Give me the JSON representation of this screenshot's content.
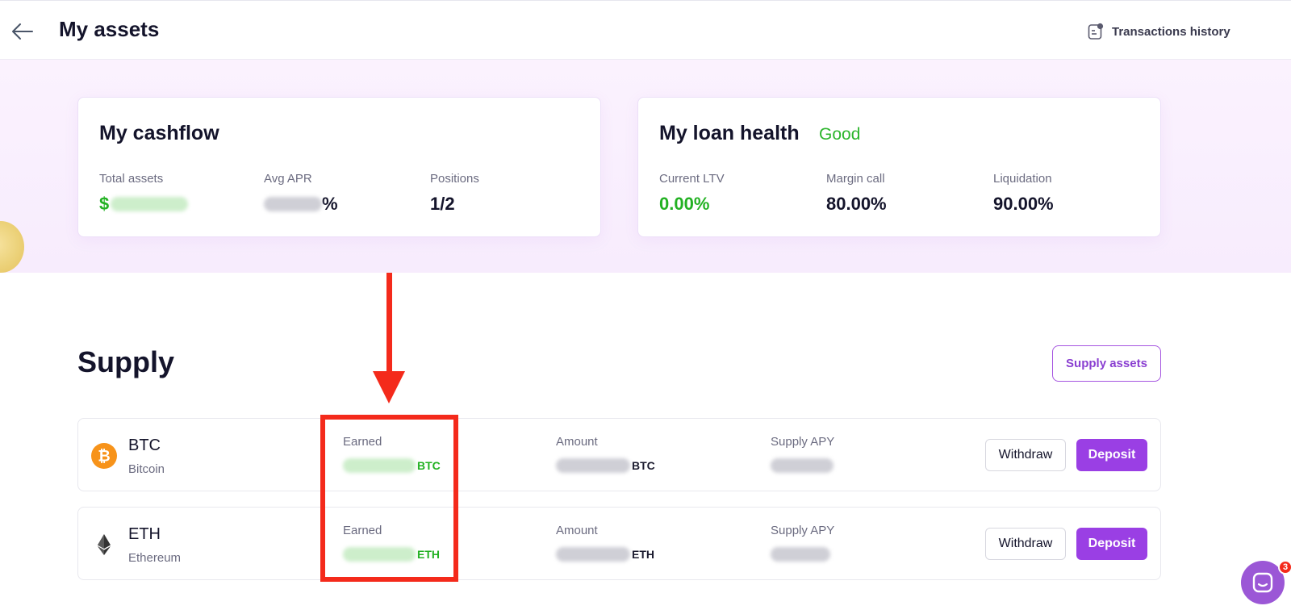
{
  "header": {
    "title": "My assets",
    "transactions_history": "Transactions history"
  },
  "cashflow": {
    "title": "My cashflow",
    "total_assets_label": "Total assets",
    "total_assets_prefix": "$",
    "avg_apr_label": "Avg APR",
    "avg_apr_suffix": "%",
    "positions_label": "Positions",
    "positions_value": "1/2"
  },
  "loan": {
    "title": "My loan health",
    "status": "Good",
    "current_ltv_label": "Current LTV",
    "current_ltv_value": "0.00%",
    "margin_call_label": "Margin call",
    "margin_call_value": "80.00%",
    "liquidation_label": "Liquidation",
    "liquidation_value": "90.00%"
  },
  "supply": {
    "title": "Supply",
    "supply_assets_button": "Supply assets",
    "rows": [
      {
        "symbol": "BTC",
        "name": "Bitcoin",
        "icon": "bitcoin-icon",
        "earned_label": "Earned",
        "earned_unit": "BTC",
        "amount_label": "Amount",
        "amount_unit": "BTC",
        "apy_label": "Supply APY",
        "withdraw": "Withdraw",
        "deposit": "Deposit"
      },
      {
        "symbol": "ETH",
        "name": "Ethereum",
        "icon": "ethereum-icon",
        "earned_label": "Earned",
        "earned_unit": "ETH",
        "amount_label": "Amount",
        "amount_unit": "ETH",
        "apy_label": "Supply APY",
        "withdraw": "Withdraw",
        "deposit": "Deposit"
      }
    ]
  },
  "chat": {
    "badge_count": "3"
  },
  "colors": {
    "accent": "#9a3fe4",
    "positive": "#22b122",
    "annotation": "#f42a1b"
  }
}
